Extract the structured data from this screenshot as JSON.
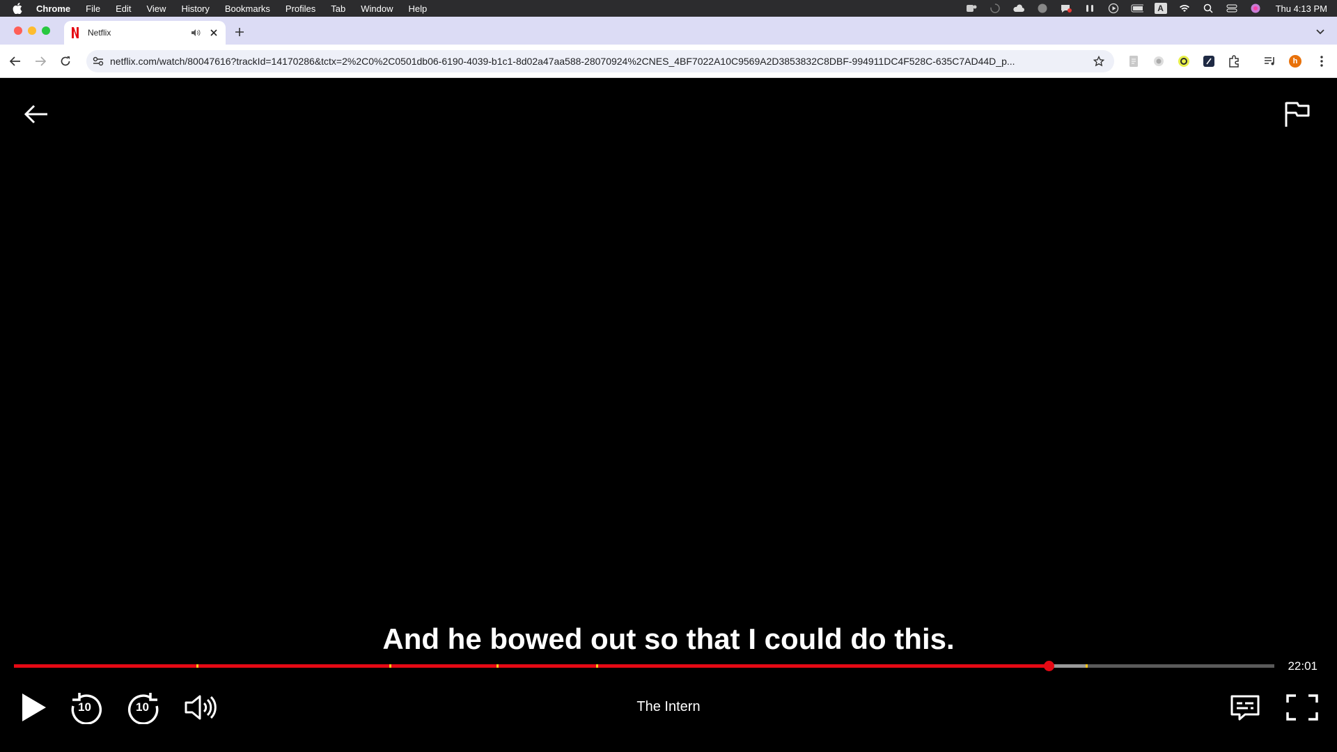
{
  "menubar": {
    "app_name": "Chrome",
    "items": [
      "File",
      "Edit",
      "View",
      "History",
      "Bookmarks",
      "Profiles",
      "Tab",
      "Window",
      "Help"
    ],
    "clock": "Thu 4:13 PM",
    "input_source": "A"
  },
  "tab": {
    "title": "Netflix",
    "favicon_letter": "N"
  },
  "toolbar": {
    "url": "netflix.com/watch/80047616?trackId=14170286&tctx=2%2C0%2C0501db06-6190-4039-b1c1-8d02a47aa588-28070924%2CNES_4BF7022A10C9569A2D3853832C8DBF-994911DC4F528C-635C7AD44D_p...",
    "profile_initial": "h"
  },
  "player": {
    "subtitle": "And he bowed out so that I could do this.",
    "title": "The Intern",
    "time_remaining": "22:01",
    "progress_played_fraction": 0.821,
    "progress_buffered_fraction": 0.85,
    "chapter_markers": [
      0.145,
      0.298,
      0.383,
      0.462,
      0.85
    ],
    "skip_back_seconds": "10",
    "skip_forward_seconds": "10"
  },
  "colors": {
    "netflix_red": "#e50914",
    "marker_yellow": "#f5c518",
    "tabstrip_bg": "#dcdcf5"
  }
}
